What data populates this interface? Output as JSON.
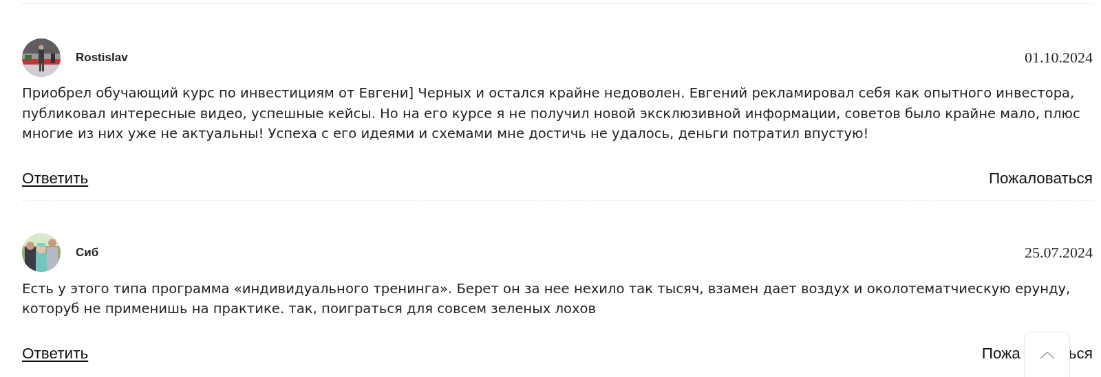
{
  "comments": [
    {
      "author": "Rostislav",
      "date": "01.10.2024",
      "avatar": {
        "kind": "picture"
      },
      "text": "Приобрел обучающий курс по инвестициям от Евгени] Черных и остался крайне недоволен. Евгений рекламировал себя как опытного инвестора, публиковал интересные видео, успешные кейсы. Но на его курсе я не получил новой эксклюзивной информации, советов было крайне мало, плюс многие из них уже не актуальны! Успеха с его идеями и схемами мне достичь не удалось, деньги потратил впустую!",
      "reply": "Ответить",
      "report": [
        "Пожаловаться"
      ]
    },
    {
      "author": "Сиб",
      "date": "25.07.2024",
      "avatar": {
        "kind": "picture"
      },
      "text": "Есть у этого типа программа «индивидуального тренинга». Берет он за нее нехило так тысяч, взамен дает воздух и околотематчиескую ерунду, которуб не применишь на практике. так, поиграться для совсем зеленых лохов",
      "reply": "Ответить",
      "report": [
        "Пожа",
        "ься"
      ]
    }
  ]
}
